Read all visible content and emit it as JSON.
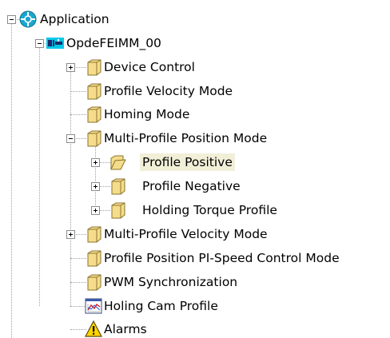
{
  "tree": {
    "root": {
      "label": "Application",
      "icon": "application-icon",
      "expanded": true
    },
    "device": {
      "label": "OpdeFEIMM_00",
      "icon": "device-icon",
      "expanded": true
    },
    "items": [
      {
        "label": "Device Control",
        "icon": "folder-icon",
        "expander": "plus"
      },
      {
        "label": "Profile Velocity Mode",
        "icon": "folder-icon",
        "expander": "none"
      },
      {
        "label": "Homing Mode",
        "icon": "folder-icon",
        "expander": "none"
      },
      {
        "label": "Multi-Profile Position Mode",
        "icon": "folder-icon",
        "expander": "minus",
        "children": [
          {
            "label": "Profile Positive",
            "icon": "folder-open-icon",
            "expander": "plus",
            "selected": true
          },
          {
            "label": "Profile Negative",
            "icon": "folder-icon",
            "expander": "plus"
          },
          {
            "label": "Holding Torque Profile",
            "icon": "folder-icon",
            "expander": "plus"
          }
        ]
      },
      {
        "label": "Multi-Profile Velocity Mode",
        "icon": "folder-icon",
        "expander": "plus"
      },
      {
        "label": "Profile Position PI-Speed Control Mode",
        "icon": "folder-icon",
        "expander": "none"
      },
      {
        "label": "PWM Synchronization",
        "icon": "folder-icon",
        "expander": "none"
      },
      {
        "label": "Holing Cam Profile",
        "icon": "cam-profile-icon",
        "expander": "none"
      },
      {
        "label": "Alarms",
        "icon": "warning-icon",
        "expander": "none"
      }
    ]
  },
  "colors": {
    "selection": "#f2efd9",
    "connector": "#a0a0a0",
    "folder": "#f5dc8a",
    "app_icon": "#19a7cf"
  }
}
